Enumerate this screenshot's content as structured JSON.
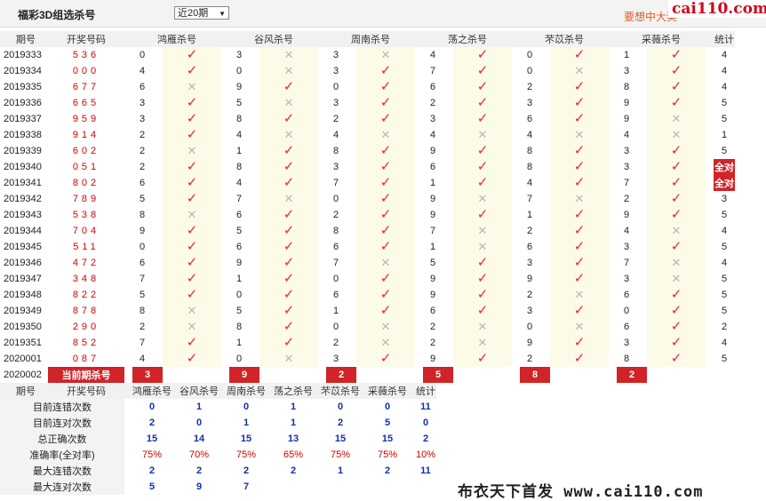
{
  "header": {
    "title": "福彩3D组选杀号",
    "period_selected": "近20期",
    "promo": "要想中大奖",
    "logo": "cai110.com"
  },
  "columns": {
    "issue": "期号",
    "draw": "开奖号码",
    "methods": [
      "鸿雁杀号",
      "谷风杀号",
      "周南杀号",
      "荡之杀号",
      "芣苡杀号",
      "采薇杀号"
    ],
    "total": "统计"
  },
  "rows": [
    {
      "issue": "2019333",
      "draw": "536",
      "kills": [
        [
          0,
          1
        ],
        [
          3,
          0
        ],
        [
          3,
          0
        ],
        [
          4,
          1
        ],
        [
          0,
          1
        ],
        [
          1,
          1
        ]
      ],
      "total": "4"
    },
    {
      "issue": "2019334",
      "draw": "000",
      "kills": [
        [
          4,
          1
        ],
        [
          0,
          0
        ],
        [
          3,
          1
        ],
        [
          7,
          1
        ],
        [
          0,
          0
        ],
        [
          3,
          1
        ]
      ],
      "total": "4"
    },
    {
      "issue": "2019335",
      "draw": "677",
      "kills": [
        [
          6,
          0
        ],
        [
          9,
          1
        ],
        [
          0,
          1
        ],
        [
          6,
          1
        ],
        [
          2,
          1
        ],
        [
          8,
          1
        ]
      ],
      "total": "4"
    },
    {
      "issue": "2019336",
      "draw": "665",
      "kills": [
        [
          3,
          1
        ],
        [
          5,
          0
        ],
        [
          3,
          1
        ],
        [
          2,
          1
        ],
        [
          3,
          1
        ],
        [
          9,
          1
        ]
      ],
      "total": "5"
    },
    {
      "issue": "2019337",
      "draw": "959",
      "kills": [
        [
          3,
          1
        ],
        [
          8,
          1
        ],
        [
          2,
          1
        ],
        [
          3,
          1
        ],
        [
          6,
          1
        ],
        [
          9,
          0
        ]
      ],
      "total": "5"
    },
    {
      "issue": "2019338",
      "draw": "914",
      "kills": [
        [
          2,
          1
        ],
        [
          4,
          0
        ],
        [
          4,
          0
        ],
        [
          4,
          0
        ],
        [
          4,
          0
        ],
        [
          4,
          0
        ]
      ],
      "total": "1"
    },
    {
      "issue": "2019339",
      "draw": "602",
      "kills": [
        [
          2,
          0
        ],
        [
          1,
          1
        ],
        [
          8,
          1
        ],
        [
          9,
          1
        ],
        [
          8,
          1
        ],
        [
          3,
          1
        ]
      ],
      "total": "5"
    },
    {
      "issue": "2019340",
      "draw": "051",
      "kills": [
        [
          2,
          1
        ],
        [
          8,
          1
        ],
        [
          3,
          1
        ],
        [
          6,
          1
        ],
        [
          8,
          1
        ],
        [
          3,
          1
        ]
      ],
      "total": "全对"
    },
    {
      "issue": "2019341",
      "draw": "802",
      "kills": [
        [
          6,
          1
        ],
        [
          4,
          1
        ],
        [
          7,
          1
        ],
        [
          1,
          1
        ],
        [
          4,
          1
        ],
        [
          7,
          1
        ]
      ],
      "total": "全对"
    },
    {
      "issue": "2019342",
      "draw": "789",
      "kills": [
        [
          5,
          1
        ],
        [
          7,
          0
        ],
        [
          0,
          1
        ],
        [
          9,
          0
        ],
        [
          7,
          0
        ],
        [
          2,
          1
        ]
      ],
      "total": "3"
    },
    {
      "issue": "2019343",
      "draw": "538",
      "kills": [
        [
          8,
          0
        ],
        [
          6,
          1
        ],
        [
          2,
          1
        ],
        [
          9,
          1
        ],
        [
          1,
          1
        ],
        [
          9,
          1
        ]
      ],
      "total": "5"
    },
    {
      "issue": "2019344",
      "draw": "704",
      "kills": [
        [
          9,
          1
        ],
        [
          5,
          1
        ],
        [
          8,
          1
        ],
        [
          7,
          0
        ],
        [
          2,
          1
        ],
        [
          4,
          0
        ]
      ],
      "total": "4"
    },
    {
      "issue": "2019345",
      "draw": "511",
      "kills": [
        [
          0,
          1
        ],
        [
          6,
          1
        ],
        [
          6,
          1
        ],
        [
          1,
          0
        ],
        [
          6,
          1
        ],
        [
          3,
          1
        ]
      ],
      "total": "5"
    },
    {
      "issue": "2019346",
      "draw": "472",
      "kills": [
        [
          6,
          1
        ],
        [
          9,
          1
        ],
        [
          7,
          0
        ],
        [
          5,
          1
        ],
        [
          3,
          1
        ],
        [
          7,
          0
        ]
      ],
      "total": "4"
    },
    {
      "issue": "2019347",
      "draw": "348",
      "kills": [
        [
          7,
          1
        ],
        [
          1,
          1
        ],
        [
          0,
          1
        ],
        [
          9,
          1
        ],
        [
          9,
          1
        ],
        [
          3,
          0
        ]
      ],
      "total": "5"
    },
    {
      "issue": "2019348",
      "draw": "822",
      "kills": [
        [
          5,
          1
        ],
        [
          0,
          1
        ],
        [
          6,
          1
        ],
        [
          9,
          1
        ],
        [
          2,
          0
        ],
        [
          6,
          1
        ]
      ],
      "total": "5"
    },
    {
      "issue": "2019349",
      "draw": "878",
      "kills": [
        [
          8,
          0
        ],
        [
          5,
          1
        ],
        [
          1,
          1
        ],
        [
          6,
          1
        ],
        [
          3,
          1
        ],
        [
          0,
          1
        ]
      ],
      "total": "5"
    },
    {
      "issue": "2019350",
      "draw": "290",
      "kills": [
        [
          2,
          0
        ],
        [
          8,
          1
        ],
        [
          0,
          0
        ],
        [
          2,
          0
        ],
        [
          0,
          0
        ],
        [
          6,
          1
        ]
      ],
      "total": "2"
    },
    {
      "issue": "2019351",
      "draw": "852",
      "kills": [
        [
          7,
          1
        ],
        [
          1,
          1
        ],
        [
          2,
          0
        ],
        [
          2,
          0
        ],
        [
          9,
          1
        ],
        [
          3,
          1
        ]
      ],
      "total": "4"
    },
    {
      "issue": "2020001",
      "draw": "087",
      "kills": [
        [
          4,
          1
        ],
        [
          0,
          0
        ],
        [
          3,
          1
        ],
        [
          9,
          1
        ],
        [
          2,
          1
        ],
        [
          8,
          1
        ]
      ],
      "total": "5"
    }
  ],
  "current": {
    "issue": "2020002",
    "label": "当前期杀号",
    "values": [
      "3",
      "9",
      "2",
      "5",
      "8",
      "2"
    ]
  },
  "stats": [
    {
      "label": "目前连错次数",
      "values": [
        "0",
        "1",
        "0",
        "1",
        "0",
        "0"
      ],
      "total": "11"
    },
    {
      "label": "目前连对次数",
      "values": [
        "2",
        "0",
        "1",
        "1",
        "2",
        "5"
      ],
      "total": "0"
    },
    {
      "label": "总正确次数",
      "values": [
        "15",
        "14",
        "15",
        "13",
        "15",
        "15"
      ],
      "total": "2"
    },
    {
      "label": "准确率(全对率)",
      "values": [
        "75%",
        "70%",
        "75%",
        "65%",
        "75%",
        "75%"
      ],
      "total": "10%"
    },
    {
      "label": "最大连错次数",
      "values": [
        "2",
        "2",
        "2",
        "2",
        "1",
        "2"
      ],
      "total": "11"
    },
    {
      "label": "最大连对次数",
      "values": [
        "5",
        "9",
        "7",
        "",
        "",
        ""
      ],
      "total": ""
    }
  ],
  "watermark": "布衣天下首发 www.cai110.com",
  "icons": {
    "check": "check-icon",
    "cross": "cross-icon"
  }
}
